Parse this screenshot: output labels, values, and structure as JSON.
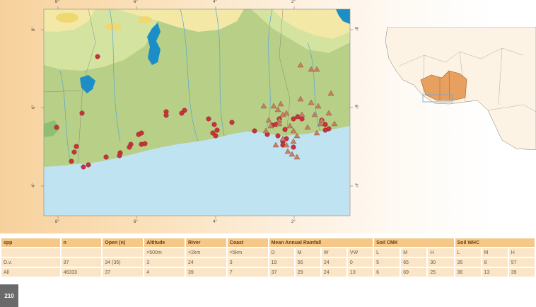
{
  "page_number": "210",
  "map": {
    "lon_labels": [
      "8°",
      "6°",
      "4°",
      "2°"
    ],
    "lat_labels": [
      "8°",
      "6°",
      "4°"
    ],
    "colors": {
      "land_lowland": "#b7cf86",
      "land_upland": "#d9e6a8",
      "savanna": "#f3e8a6",
      "ocean": "#bfe3f1",
      "water": "#1b8ec8",
      "marker_circle": "#c8323a",
      "marker_triangle": "#c77f62"
    },
    "marker_legend": {
      "circle": "D.v. record (circle marker)",
      "triangle": "additional record (triangle marker)"
    }
  },
  "table": {
    "headers": [
      "spp",
      "n",
      "Open (n)",
      "Altitude",
      "River",
      "Coast",
      "Mean Annual Rainfall",
      "Soil  CMK",
      "Soil WHC"
    ],
    "subheader": [
      "",
      "",
      "",
      ">500m",
      "<2km",
      "<5km",
      "D",
      "M",
      "W",
      "VW",
      "L",
      "M",
      "H",
      "L",
      "M",
      "H"
    ],
    "rows": [
      {
        "spp": "D.v.",
        "cells": [
          "37",
          "34 (35)",
          "3",
          "24",
          "3",
          "19",
          "56",
          "24",
          "0",
          "5",
          "65",
          "30",
          "35",
          "8",
          "57"
        ]
      },
      {
        "spp": "All",
        "cells": [
          "46333",
          "37",
          "4",
          "39",
          "7",
          "37",
          "29",
          "24",
          "10",
          "6",
          "69",
          "25",
          "36",
          "13",
          "39"
        ]
      }
    ]
  }
}
